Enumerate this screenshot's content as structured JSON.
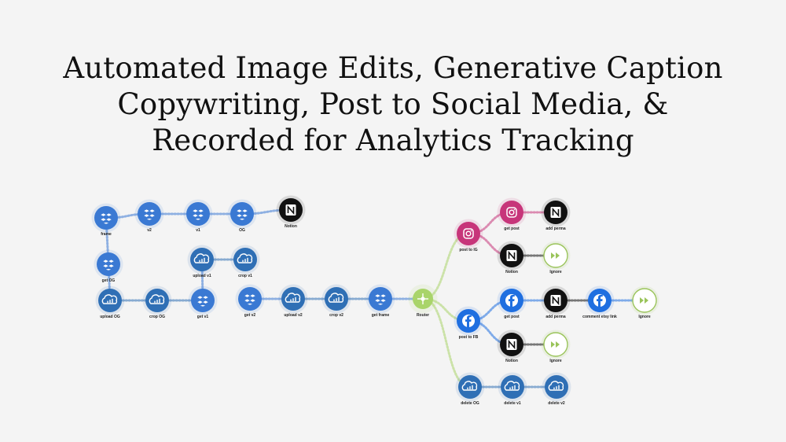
{
  "title_lines": [
    "Automated Image Edits, Generative Caption",
    "Copywriting, Post to Social Media, &",
    "Recorded for Analytics Tracking"
  ],
  "colors": {
    "dropbox": "#3a79d3",
    "cloudinary": "#2f6fb5",
    "instagram": "#c7357a",
    "notion": "#111111",
    "facebook": "#1f6fe0",
    "router": "#a9d46a",
    "ignore": "#9ac45a",
    "background": "#f4f4f4"
  },
  "nodes": [
    {
      "id": "frame",
      "label": "frame",
      "service": "dropbox",
      "icon": "dropbox-icon"
    },
    {
      "id": "v2",
      "label": "v2",
      "service": "dropbox",
      "icon": "dropbox-icon"
    },
    {
      "id": "v1",
      "label": "v1",
      "service": "dropbox",
      "icon": "dropbox-icon"
    },
    {
      "id": "og",
      "label": "OG",
      "service": "dropbox",
      "icon": "dropbox-icon"
    },
    {
      "id": "notion-top",
      "label": "Notion",
      "service": "notion",
      "icon": "notion-icon"
    },
    {
      "id": "get-og",
      "label": "get OG",
      "service": "dropbox",
      "icon": "dropbox-icon"
    },
    {
      "id": "upload-v1",
      "label": "upload v1",
      "service": "cloudinary",
      "icon": "cloud-icon"
    },
    {
      "id": "crop-v1",
      "label": "crop v1",
      "service": "cloudinary",
      "icon": "cloud-icon"
    },
    {
      "id": "upload-og",
      "label": "upload OG",
      "service": "cloudinary",
      "icon": "cloud-icon"
    },
    {
      "id": "crop-og",
      "label": "crop OG",
      "service": "cloudinary",
      "icon": "cloud-icon"
    },
    {
      "id": "get-v1",
      "label": "get v1",
      "service": "dropbox",
      "icon": "dropbox-icon"
    },
    {
      "id": "get-v2",
      "label": "get v2",
      "service": "dropbox",
      "icon": "dropbox-icon"
    },
    {
      "id": "upload-v2",
      "label": "upload v2",
      "service": "cloudinary",
      "icon": "cloud-icon"
    },
    {
      "id": "crop-v2",
      "label": "crop v2",
      "service": "cloudinary",
      "icon": "cloud-icon"
    },
    {
      "id": "get-frame",
      "label": "get frame",
      "service": "dropbox",
      "icon": "dropbox-icon"
    },
    {
      "id": "router",
      "label": "Router",
      "service": "router",
      "icon": "router-icon"
    },
    {
      "id": "post-ig",
      "label": "post to IG",
      "service": "instagram",
      "icon": "instagram-icon"
    },
    {
      "id": "get-post-ig",
      "label": "get post",
      "service": "instagram",
      "icon": "instagram-icon"
    },
    {
      "id": "add-perma-ig",
      "label": "add perma",
      "service": "notion",
      "icon": "notion-icon"
    },
    {
      "id": "notion-ig",
      "label": "Notion",
      "service": "notion",
      "icon": "notion-icon"
    },
    {
      "id": "ignore-ig",
      "label": "Ignore",
      "service": "ignore",
      "icon": "ignore-icon"
    },
    {
      "id": "post-fb",
      "label": "post to FB",
      "service": "facebook",
      "icon": "facebook-icon"
    },
    {
      "id": "get-post-fb",
      "label": "get post",
      "service": "facebook",
      "icon": "facebook-icon"
    },
    {
      "id": "add-perma-fb",
      "label": "add perma",
      "service": "notion",
      "icon": "notion-icon"
    },
    {
      "id": "comment-link",
      "label": "comment etsy link",
      "service": "facebook",
      "icon": "facebook-icon"
    },
    {
      "id": "ignore-fb2",
      "label": "Ignore",
      "service": "ignore",
      "icon": "ignore-icon"
    },
    {
      "id": "notion-fb",
      "label": "Notion",
      "service": "notion",
      "icon": "notion-icon"
    },
    {
      "id": "ignore-fb",
      "label": "Ignore",
      "service": "ignore",
      "icon": "ignore-icon"
    },
    {
      "id": "delete-og",
      "label": "delete OG",
      "service": "cloudinary",
      "icon": "cloud-icon"
    },
    {
      "id": "delete-v1",
      "label": "delete v1",
      "service": "cloudinary",
      "icon": "cloud-icon"
    },
    {
      "id": "delete-v2",
      "label": "delete v2",
      "service": "cloudinary",
      "icon": "cloud-icon"
    }
  ],
  "edges": [
    [
      "frame",
      "v2"
    ],
    [
      "v2",
      "v1"
    ],
    [
      "v1",
      "og"
    ],
    [
      "og",
      "notion-top"
    ],
    [
      "frame",
      "get-og"
    ],
    [
      "get-og",
      "upload-og"
    ],
    [
      "upload-og",
      "crop-og"
    ],
    [
      "crop-og",
      "get-v1"
    ],
    [
      "get-v1",
      "upload-v1"
    ],
    [
      "upload-v1",
      "crop-v1"
    ],
    [
      "get-v2",
      "upload-v2"
    ],
    [
      "upload-v2",
      "crop-v2"
    ],
    [
      "crop-v2",
      "get-frame"
    ],
    [
      "get-frame",
      "router"
    ],
    [
      "router",
      "post-ig"
    ],
    [
      "router",
      "post-fb"
    ],
    [
      "router",
      "delete-og"
    ],
    [
      "post-ig",
      "get-post-ig"
    ],
    [
      "get-post-ig",
      "add-perma-ig"
    ],
    [
      "post-ig",
      "notion-ig"
    ],
    [
      "notion-ig",
      "ignore-ig"
    ],
    [
      "post-fb",
      "get-post-fb"
    ],
    [
      "get-post-fb",
      "add-perma-fb"
    ],
    [
      "add-perma-fb",
      "comment-link"
    ],
    [
      "comment-link",
      "ignore-fb2"
    ],
    [
      "post-fb",
      "notion-fb"
    ],
    [
      "notion-fb",
      "ignore-fb"
    ],
    [
      "delete-og",
      "delete-v1"
    ],
    [
      "delete-v1",
      "delete-v2"
    ]
  ]
}
